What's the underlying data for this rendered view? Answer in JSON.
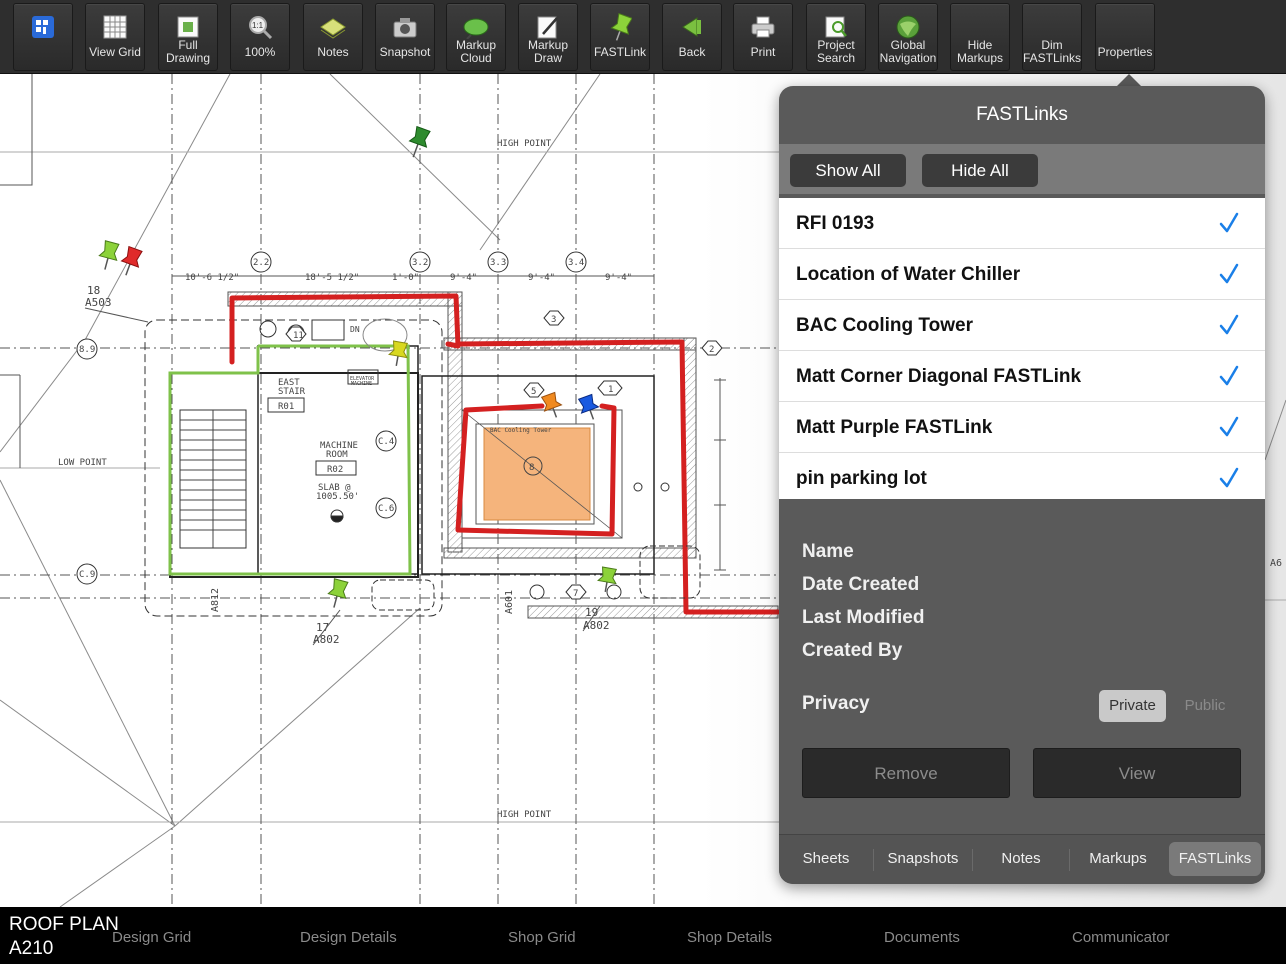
{
  "toolbar": {
    "buttons": [
      {
        "label": "",
        "icon": "app-menu-icon"
      },
      {
        "label": "View Grid",
        "icon": "grid-icon"
      },
      {
        "label": "Full\nDrawing",
        "icon": "full-drawing-icon"
      },
      {
        "label": "100%",
        "icon": "zoom-100-icon"
      },
      {
        "label": "Notes",
        "icon": "notes-icon"
      },
      {
        "label": "Snapshot",
        "icon": "camera-icon"
      },
      {
        "label": "Markup\nCloud",
        "icon": "markup-cloud-icon"
      },
      {
        "label": "Markup\nDraw",
        "icon": "markup-draw-icon"
      },
      {
        "label": "FASTLink",
        "icon": "pushpin-icon"
      },
      {
        "label": "Back",
        "icon": "back-arrow-icon"
      },
      {
        "label": "Print",
        "icon": "printer-icon"
      },
      {
        "label": "Project\nSearch",
        "icon": "project-search-icon"
      },
      {
        "label": "Global\nNavigation",
        "icon": "globe-icon"
      },
      {
        "label": "Hide\nMarkups",
        "icon": ""
      },
      {
        "label": "Dim\nFASTLinks",
        "icon": ""
      },
      {
        "label": "Properties",
        "icon": ""
      }
    ]
  },
  "drawing": {
    "labels": {
      "high_point_top": "HIGH POINT",
      "high_point_bottom": "HIGH POINT",
      "low_point": "LOW POINT",
      "east_stair": "EAST\nSTAIR",
      "r01": "R01",
      "machine_room": "MACHINE\nROOM",
      "r02": "R02",
      "slab": "SLAB @\n1005.50'",
      "bac_tower": "BAC Cooling Tower",
      "ref_18_num": "18",
      "ref_18_sheet": "A503",
      "ref_17_num": "17",
      "ref_17_sheet": "A802",
      "ref_19_num": "19",
      "ref_19_sheet": "A802",
      "grid_22": "2.2",
      "grid_32": "3.2",
      "grid_33": "3.3",
      "grid_34": "3.4",
      "grid_89": "8.9",
      "grid_c9": "C.9",
      "grid_c4": "C.4",
      "grid_c6": "C.6",
      "dim_1": "10'-6 1/2\"",
      "dim_2": "18'-5 1/2\"",
      "dim_3": "9'-4\"",
      "dim_4": "9'-4\"",
      "dim_5": "9'-4\"",
      "dim_6": "1'-0\"",
      "elev_machine": "ELEVATOR\nMACHINE",
      "dn": "DN",
      "a601": "A601",
      "a812": "A812",
      "a6_edge": "A6"
    }
  },
  "popover": {
    "title": "FASTLinks",
    "show_all": "Show All",
    "hide_all": "Hide All",
    "items": [
      {
        "label": "RFI 0193",
        "checked": true
      },
      {
        "label": "Location of  Water Chiller",
        "checked": true
      },
      {
        "label": "BAC Cooling Tower",
        "checked": true
      },
      {
        "label": "Matt Corner Diagonal FASTLink",
        "checked": true
      },
      {
        "label": "Matt Purple FASTLink",
        "checked": true
      },
      {
        "label": "pin parking lot",
        "checked": true
      }
    ],
    "properties": {
      "name": "Name",
      "date_created": "Date Created",
      "last_modified": "Last Modified",
      "created_by": "Created By",
      "privacy": "Privacy"
    },
    "privacy_options": {
      "private": "Private",
      "public": "Public",
      "selected": "Private"
    },
    "remove": "Remove",
    "view": "View",
    "tabs": [
      "Sheets",
      "Snapshots",
      "Notes",
      "Markups",
      "FASTLinks"
    ],
    "selected_tab": "FASTLinks",
    "accent_color": "#1a7fe8"
  },
  "bottombar": {
    "sheet_name": "ROOF PLAN",
    "sheet_number": "A210",
    "nav": [
      "Design Grid",
      "Design Details",
      "Shop Grid",
      "Shop Details",
      "Documents",
      "Communicator"
    ]
  }
}
